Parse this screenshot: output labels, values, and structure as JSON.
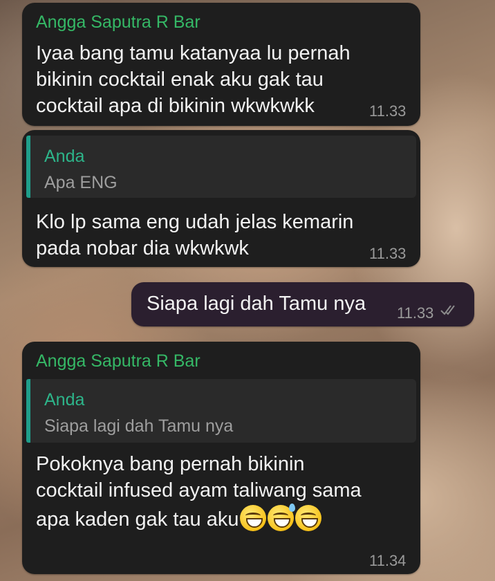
{
  "messages": [
    {
      "sender": "Angga Saputra R Bar",
      "lines": [
        "Iyaa bang tamu katanyaa lu pernah",
        "bikinin cocktail enak aku gak tau",
        "cocktail apa di bikinin wkwkwkk"
      ],
      "time": "11.33"
    },
    {
      "quote": {
        "name": "Anda",
        "text": "Apa ENG"
      },
      "lines": [
        "Klo lp sama eng udah jelas kemarin",
        "pada nobar dia wkwkwk"
      ],
      "time": "11.33"
    },
    {
      "outgoing": true,
      "text": "Siapa lagi dah Tamu nya",
      "time": "11.33",
      "status": "read"
    },
    {
      "sender": "Angga Saputra R Bar",
      "quote": {
        "name": "Anda",
        "text": "Siapa lagi dah Tamu nya"
      },
      "lines": [
        "Pokoknya bang pernah bikinin",
        "cocktail infused ayam taliwang sama",
        "apa kaden gak tau aku"
      ],
      "emojis": [
        "rolling-on-floor-laughing-emoji",
        "grinning-sweat-emoji",
        "grinning-sweat-emoji"
      ],
      "time": "11.34"
    }
  ],
  "colors": {
    "bubble_incoming": "#1e1e1e",
    "bubble_outgoing": "#2b1f2f",
    "sender_name": "#35b866",
    "quote_accent": "#1f9e8a",
    "timestamp": "#9a9a9a"
  }
}
